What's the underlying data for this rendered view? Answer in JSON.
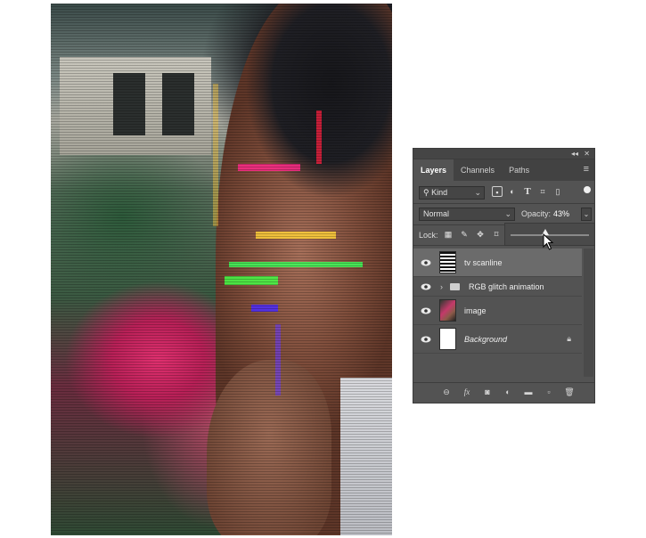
{
  "panel": {
    "tabs": [
      {
        "label": "Layers",
        "active": true
      },
      {
        "label": "Channels",
        "active": false
      },
      {
        "label": "Paths",
        "active": false
      }
    ],
    "filter": {
      "label": "Kind",
      "icons": [
        "image-filter-icon",
        "adjustment-filter-icon",
        "type-filter-icon",
        "shape-filter-icon",
        "smart-object-filter-icon"
      ]
    },
    "blend_mode": "Normal",
    "opacity_label": "Opacity:",
    "opacity_value": "43%",
    "opacity_slider_value": 0.43,
    "lock_label": "Lock:",
    "lock_icons": [
      "lock-transparent-pixels-icon",
      "lock-image-pixels-icon",
      "lock-position-icon",
      "lock-artboard-icon"
    ],
    "layers": [
      {
        "name": "tv scanline",
        "type": "layer",
        "selected": true,
        "visible": true
      },
      {
        "name": "RGB glitch animation",
        "type": "group",
        "selected": false,
        "visible": true
      },
      {
        "name": "image",
        "type": "layer",
        "selected": false,
        "visible": true
      },
      {
        "name": "Background",
        "type": "background",
        "selected": false,
        "visible": true,
        "locked": true
      }
    ],
    "bottom_icons": [
      "link-layers-icon",
      "layer-style-icon",
      "add-mask-icon",
      "adjustment-layer-icon",
      "new-group-icon",
      "new-layer-icon",
      "delete-layer-icon"
    ]
  },
  "colors": {
    "panel_bg": "#535353",
    "selected_layer": "#6b6b6b"
  }
}
